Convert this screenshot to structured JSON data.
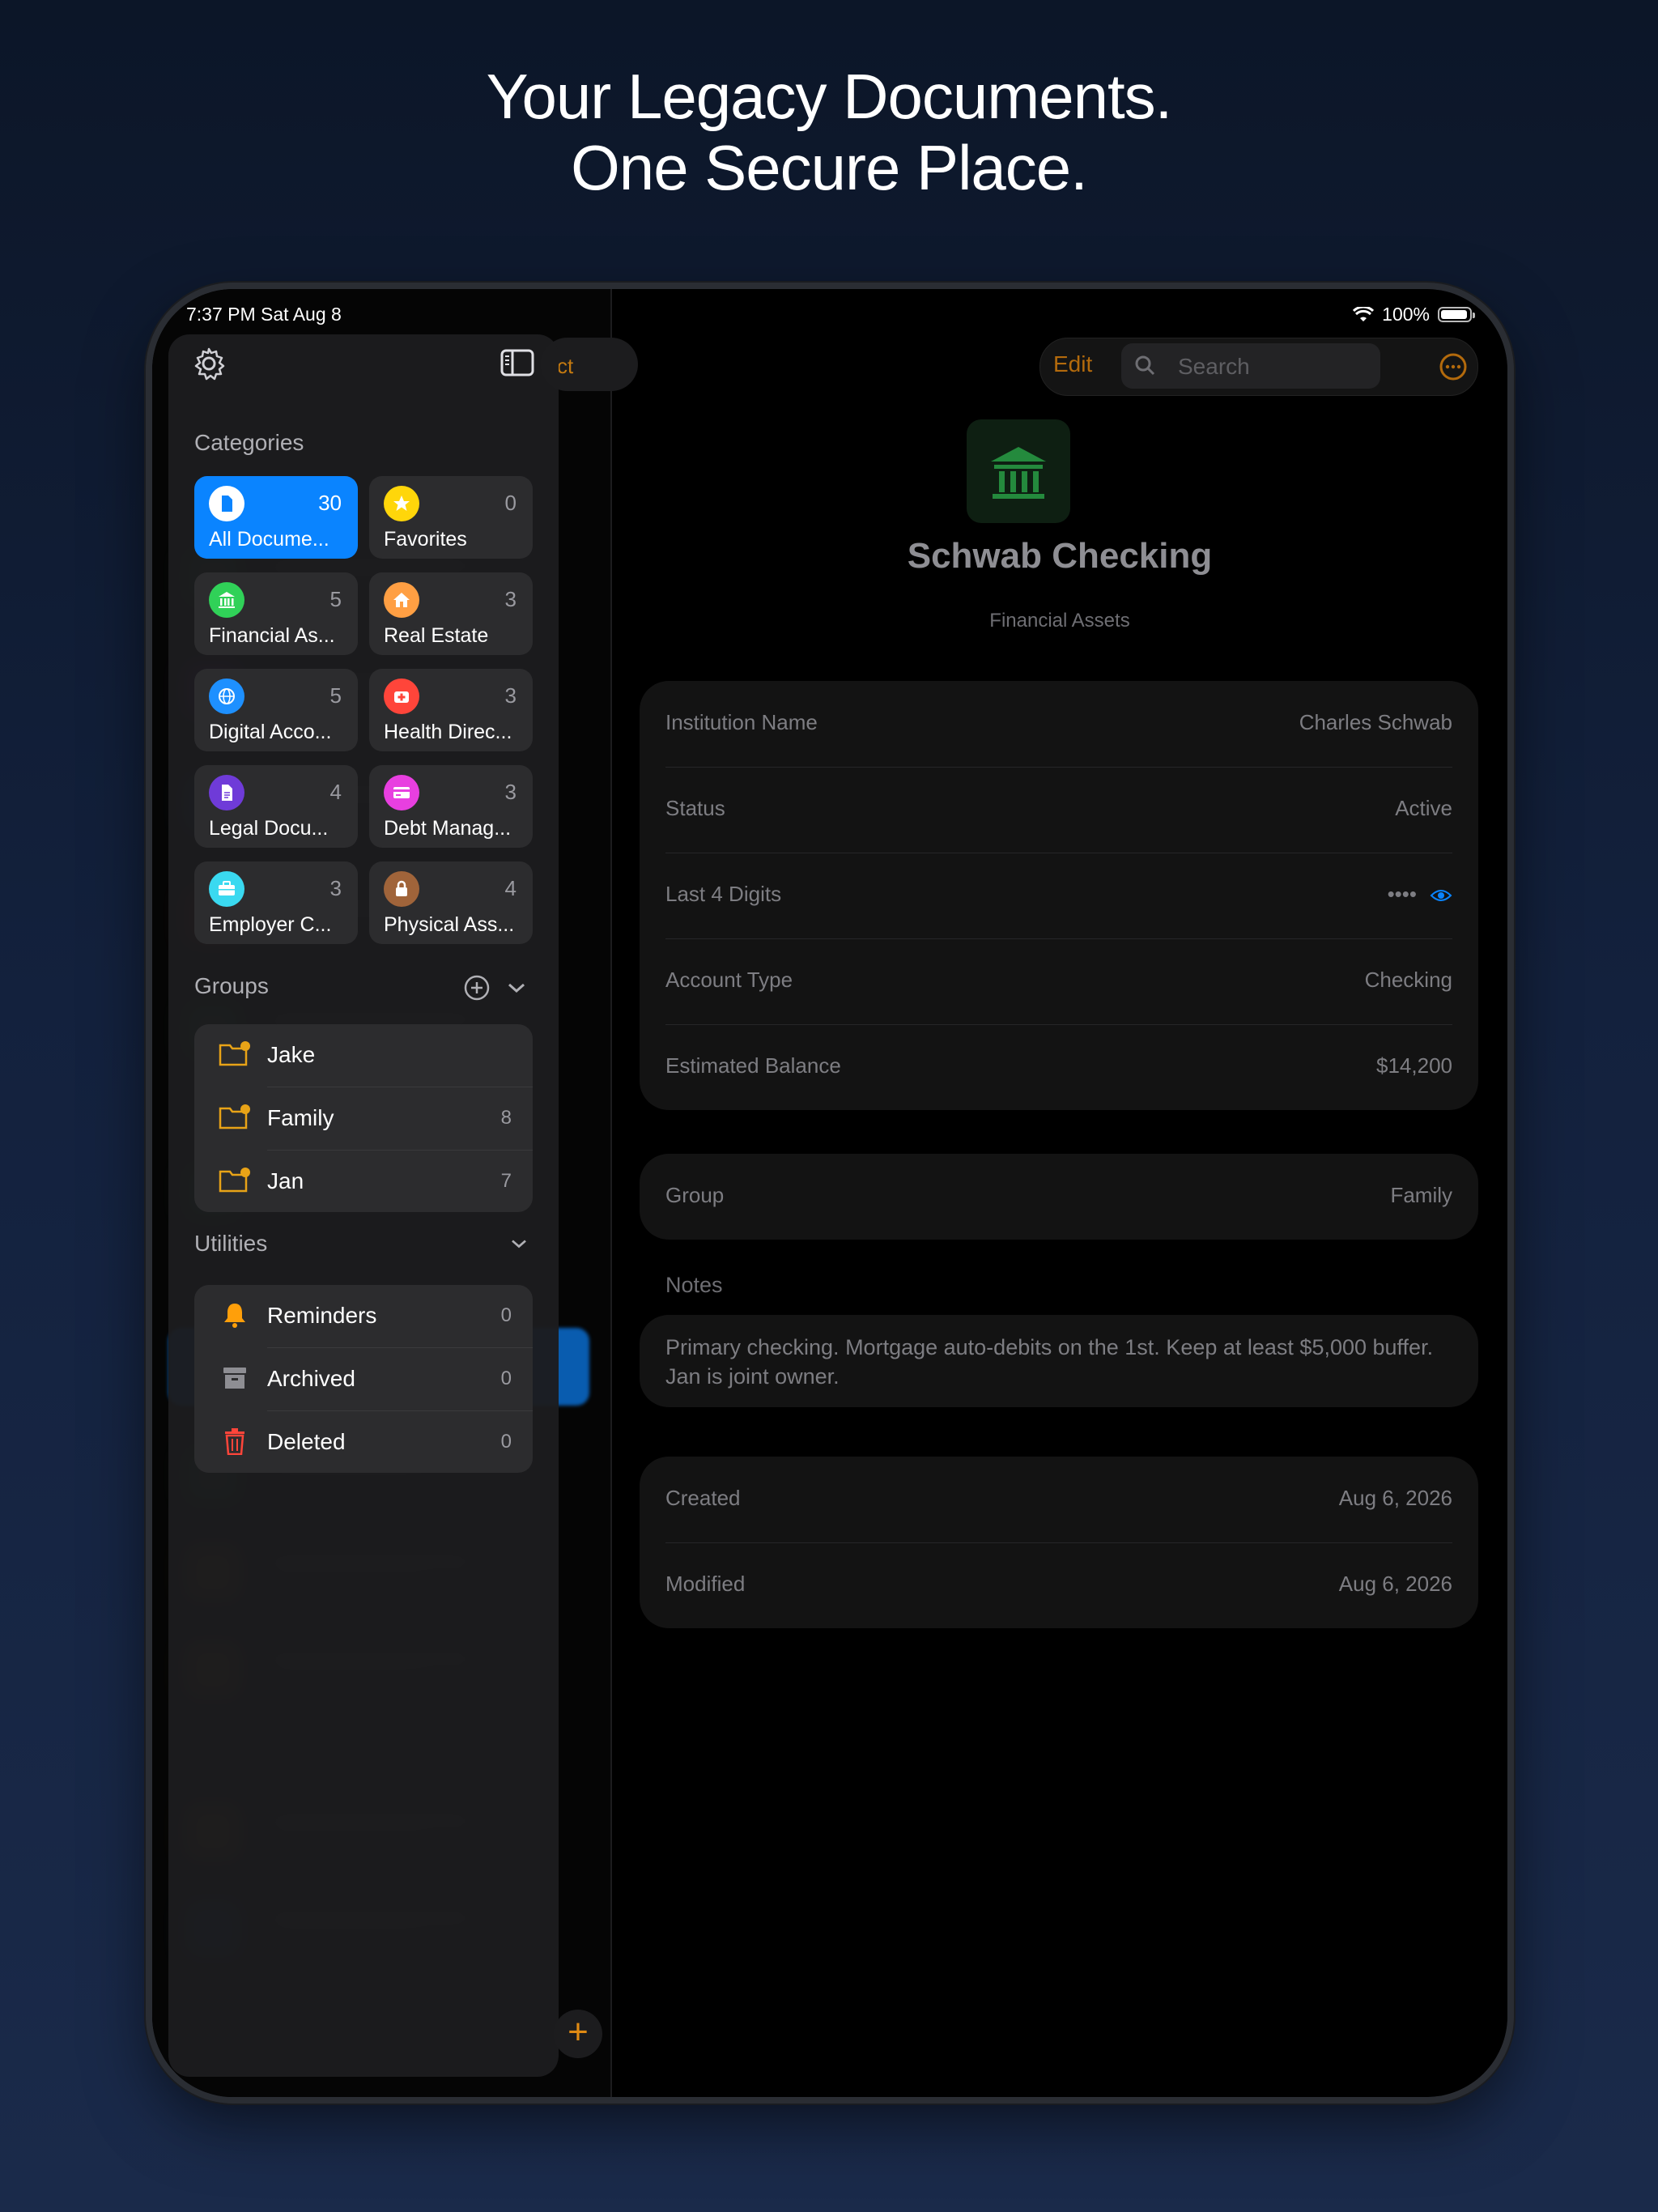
{
  "headline": {
    "line1": "Your Legacy Documents.",
    "line2": "One Secure Place."
  },
  "status_bar": {
    "time": "7:37 PM  Sat Aug 8",
    "battery": "100%"
  },
  "list_panel": {
    "select_label": "ct"
  },
  "toolbar": {
    "edit_label": "Edit",
    "search_placeholder": "Search"
  },
  "document": {
    "title": "Schwab Checking",
    "category": "Financial Assets",
    "details": [
      {
        "label": "Institution Name",
        "value": "Charles Schwab"
      },
      {
        "label": "Status",
        "value": "Active"
      },
      {
        "label": "Last 4 Digits",
        "value": "••••"
      },
      {
        "label": "Account Type",
        "value": "Checking"
      },
      {
        "label": "Estimated Balance",
        "value": "$14,200"
      }
    ],
    "group": {
      "label": "Group",
      "value": "Family"
    },
    "notes_label": "Notes",
    "notes": "Primary checking. Mortgage auto-debits on the 1st. Keep at least $5,000 buffer. Jan is joint owner.",
    "created": {
      "label": "Created",
      "value": "Aug 6, 2026"
    },
    "modified": {
      "label": "Modified",
      "value": "Aug 6, 2026"
    }
  },
  "sidebar": {
    "categories_title": "Categories",
    "categories": [
      {
        "label": "All Docume...",
        "count": "30",
        "color": "#0a84ff",
        "icon": "document-icon"
      },
      {
        "label": "Favorites",
        "count": "0",
        "color": "#ffd60a",
        "icon": "star-icon"
      },
      {
        "label": "Financial As...",
        "count": "5",
        "color": "#30d158",
        "icon": "bank-icon"
      },
      {
        "label": "Real Estate",
        "count": "3",
        "color": "#ff9f43",
        "icon": "house-icon"
      },
      {
        "label": "Digital Acco...",
        "count": "5",
        "color": "#1e90ff",
        "icon": "globe-icon"
      },
      {
        "label": "Health Direc...",
        "count": "3",
        "color": "#ff453a",
        "icon": "medical-icon"
      },
      {
        "label": "Legal Docu...",
        "count": "4",
        "color": "#6f3bd8",
        "icon": "legal-doc-icon"
      },
      {
        "label": "Debt Manag...",
        "count": "3",
        "color": "#e83fe0",
        "icon": "credit-card-icon"
      },
      {
        "label": "Employer C...",
        "count": "3",
        "color": "#3ad9f0",
        "icon": "briefcase-icon"
      },
      {
        "label": "Physical Ass...",
        "count": "4",
        "color": "#a0643a",
        "icon": "lock-icon"
      }
    ],
    "groups_title": "Groups",
    "groups": [
      {
        "label": "Jake",
        "count": ""
      },
      {
        "label": "Family",
        "count": "8"
      },
      {
        "label": "Jan",
        "count": "7"
      }
    ],
    "utilities_title": "Utilities",
    "utilities": [
      {
        "label": "Reminders",
        "count": "0",
        "icon": "bell-icon"
      },
      {
        "label": "Archived",
        "count": "0",
        "icon": "archive-icon"
      },
      {
        "label": "Deleted",
        "count": "0",
        "icon": "trash-icon"
      }
    ]
  }
}
